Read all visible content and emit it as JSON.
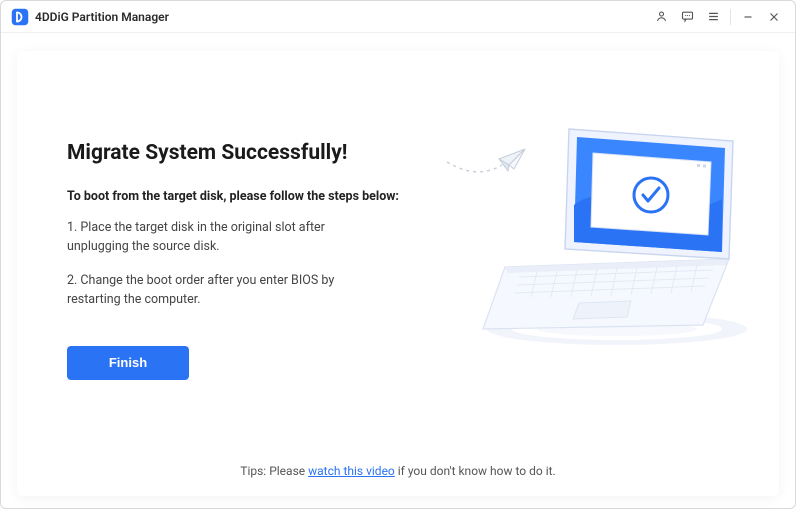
{
  "titlebar": {
    "app_name": "4DDiG Partition Manager"
  },
  "content": {
    "heading": "Migrate System Successfully!",
    "sub": "To boot from the target disk, please follow the steps below:",
    "step1": "1. Place the target disk in the original slot after unplugging the source disk.",
    "step2": "2. Change the boot order after you enter BIOS by restarting the computer.",
    "finish_label": "Finish"
  },
  "tips": {
    "prefix": "Tips: Please ",
    "link_text": "watch this video",
    "suffix": " if you don't know how to do it."
  }
}
